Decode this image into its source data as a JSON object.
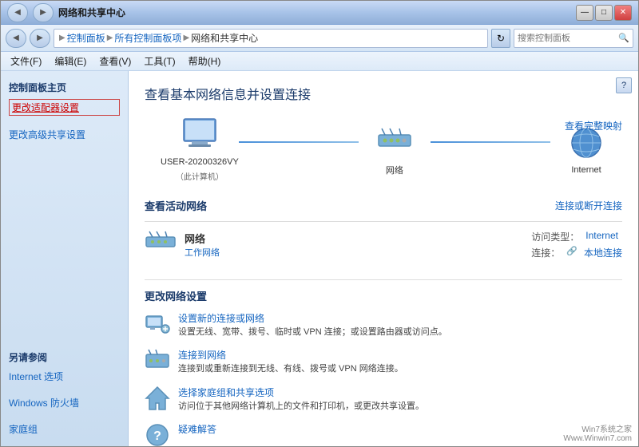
{
  "window": {
    "title": "网络和共享中心"
  },
  "titlebar": {
    "controls": {
      "minimize": "—",
      "maximize": "□",
      "close": "✕"
    }
  },
  "addressbar": {
    "back_icon": "◀",
    "forward_icon": "▶",
    "breadcrumbs": [
      {
        "label": "控制面板",
        "active": false
      },
      {
        "label": "所有控制面板项",
        "active": false
      },
      {
        "label": "网络和共享中心",
        "active": true
      }
    ],
    "refresh_icon": "↻",
    "search_placeholder": "搜索控制面板"
  },
  "menubar": {
    "items": [
      {
        "label": "文件(F)"
      },
      {
        "label": "编辑(E)"
      },
      {
        "label": "查看(V)"
      },
      {
        "label": "工具(T)"
      },
      {
        "label": "帮助(H)"
      }
    ]
  },
  "sidebar": {
    "section1_title": "控制面板主页",
    "links": [
      {
        "label": "更改适配器设置",
        "active": true
      },
      {
        "label": "更改高级共享设置",
        "active": false
      }
    ],
    "section2_title": "另请参阅",
    "links2": [
      {
        "label": "Internet 选项"
      },
      {
        "label": "Windows 防火墙"
      },
      {
        "label": "家庭组"
      }
    ]
  },
  "content": {
    "title": "查看基本网络信息并设置连接",
    "view_full_map": "查看完整映射",
    "network_nodes": [
      {
        "label": "USER-20200326VY",
        "sublabel": "（此计算机）",
        "type": "computer"
      },
      {
        "label": "网络",
        "sublabel": "",
        "type": "network"
      },
      {
        "label": "Internet",
        "sublabel": "",
        "type": "globe"
      }
    ],
    "active_network_section": "查看活动网络",
    "connect_or_disconnect": "连接或断开连接",
    "network_name": "网络",
    "network_subtype": "工作网络",
    "access_type_label": "访问类型：",
    "access_type_value": "Internet",
    "connection_label": "连接：",
    "connection_value": "本地连接",
    "connection_icon": "🔗",
    "change_settings_title": "更改网络设置",
    "settings_items": [
      {
        "link": "设置新的连接或网络",
        "desc": "设置无线、宽带、拨号、临时或 VPN 连接；或设置路由器或访问点。",
        "icon": "setup"
      },
      {
        "link": "连接到网络",
        "desc": "连接到或重新连接到无线、有线、拨号或 VPN 网络连接。",
        "icon": "connect"
      },
      {
        "link": "选择家庭组和共享选项",
        "desc": "访问位于其他网络计算机上的文件和打印机，或更改共享设置。",
        "icon": "homegroup"
      },
      {
        "link": "疑难解答",
        "desc": "",
        "icon": "troubleshoot"
      }
    ]
  },
  "watermark": {
    "line1": "Win7系统之家",
    "line2": "Www.Winwin7.com"
  }
}
